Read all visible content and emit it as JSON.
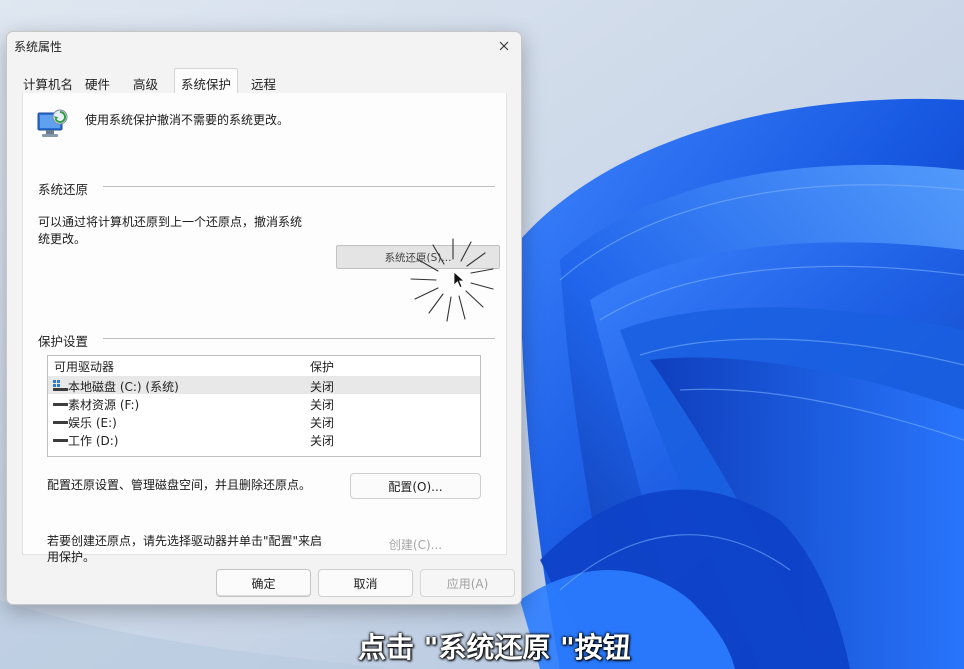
{
  "window": {
    "title": "系统属性",
    "tabs": [
      {
        "label": "计算机名"
      },
      {
        "label": "硬件"
      },
      {
        "label": "高级"
      },
      {
        "label": "系统保护"
      },
      {
        "label": "远程"
      }
    ],
    "active_tab": "系统保护"
  },
  "intro": {
    "text": "使用系统保护撤消不需要的系统更改。",
    "icon": "system-protection-icon"
  },
  "restore": {
    "group_label": "系统还原",
    "description_line1": "可以通过将计算机还原到上一个还原点，撤消系统",
    "description_line2": "统更改。",
    "button_label": "系统还原(S)..."
  },
  "protection": {
    "group_label": "保护设置",
    "columns": [
      "可用驱动器",
      "保护"
    ],
    "drives": [
      {
        "name": "本地磁盘 (C:) (系统)",
        "protection": "关闭",
        "icon": "system-drive-icon",
        "selected": true
      },
      {
        "name": "素材资源 (F:)",
        "protection": "关闭",
        "icon": "drive-icon",
        "selected": false
      },
      {
        "name": "娱乐 (E:)",
        "protection": "关闭",
        "icon": "drive-icon",
        "selected": false
      },
      {
        "name": "工作 (D:)",
        "protection": "关闭",
        "icon": "drive-icon",
        "selected": false
      }
    ],
    "configure_text": "配置还原设置、管理磁盘空间，并且删除还原点。",
    "configure_button": "配置(O)...",
    "create_text_line1": "若要创建还原点，请先选择驱动器并单击\"配置\"来启",
    "create_text_line2": "用保护。",
    "create_button": "创建(C)..."
  },
  "footer": {
    "ok": "确定",
    "cancel": "取消",
    "apply": "应用(A)"
  },
  "caption": "点击 \"系统还原 \"按钮",
  "colors": {
    "window_bg": "#f3f3f3",
    "panel_bg": "#fdfdfd",
    "wallpaper_blue": "#1a5fe0",
    "wallpaper_bg": "#c9d6e6"
  }
}
